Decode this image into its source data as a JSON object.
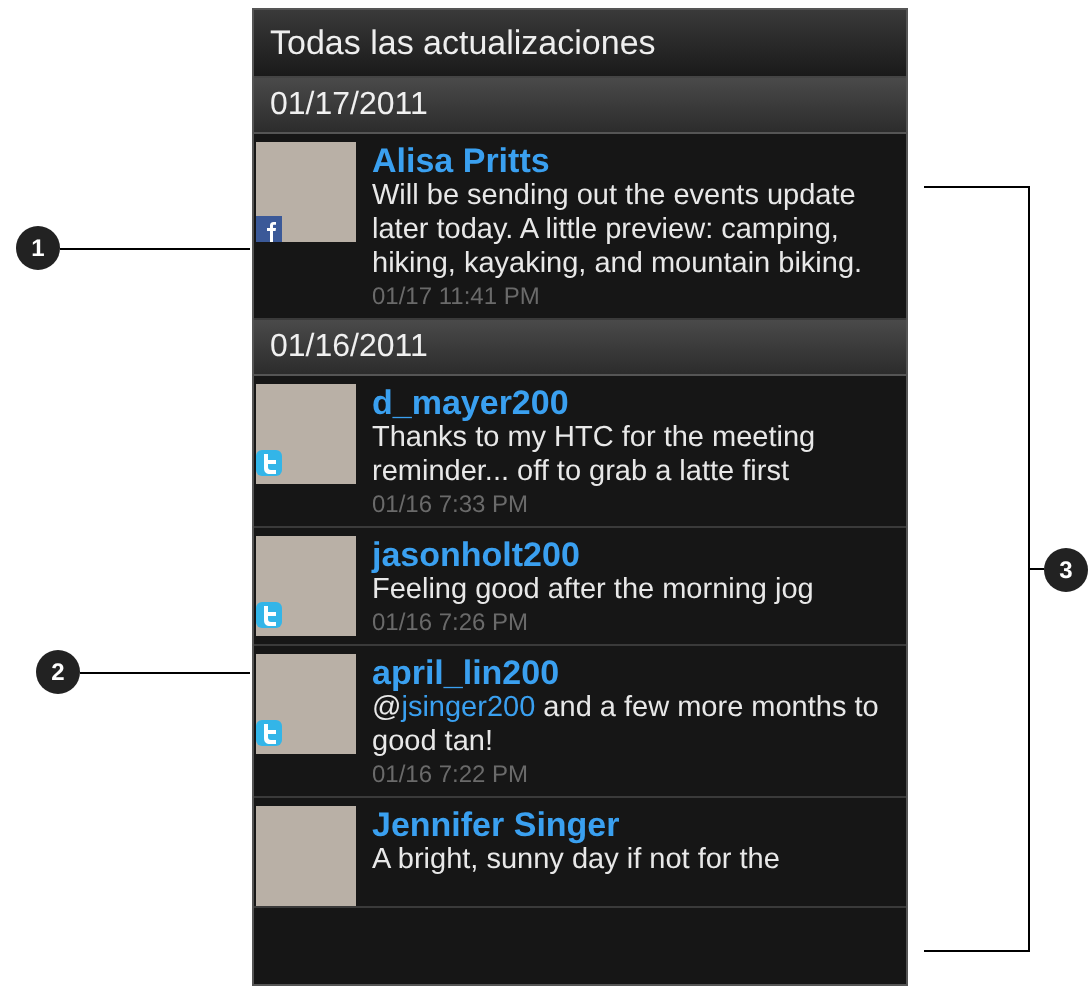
{
  "header": {
    "title": "Todas las actualizaciones"
  },
  "groups": [
    {
      "date": "01/17/2011",
      "posts": [
        {
          "author": "Alisa Pritts",
          "kind": "facebook",
          "message": [
            {
              "text": "Will be sending out the events update later today. A little preview: camping, hiking, kayaking, and mountain biking.",
              "link": false
            }
          ],
          "time": "01/17 11:41 PM"
        }
      ]
    },
    {
      "date": "01/16/2011",
      "posts": [
        {
          "author": "d_mayer200",
          "kind": "twitter",
          "message": [
            {
              "text": "Thanks to my HTC for the meeting reminder... off to grab a latte first",
              "link": false
            }
          ],
          "time": "01/16 7:33 PM"
        },
        {
          "author": "jasonholt200",
          "kind": "twitter",
          "message": [
            {
              "text": "Feeling good after the morning jog",
              "link": false
            }
          ],
          "time": "01/16 7:26 PM"
        },
        {
          "author": "april_lin200",
          "kind": "twitter",
          "message": [
            {
              "text": "@",
              "link": false
            },
            {
              "text": "jsinger200",
              "link": true
            },
            {
              "text": " and a few more months to good tan!",
              "link": false
            }
          ],
          "time": "01/16 7:22 PM"
        },
        {
          "author": "Jennifer Singer",
          "kind": "plain",
          "message": [
            {
              "text": "A bright, sunny day if not for the",
              "link": false
            }
          ]
        }
      ]
    }
  ],
  "callouts": [
    {
      "label": "1",
      "kind": "left"
    },
    {
      "label": "2",
      "kind": "left"
    },
    {
      "label": "3",
      "kind": "bracket"
    }
  ]
}
